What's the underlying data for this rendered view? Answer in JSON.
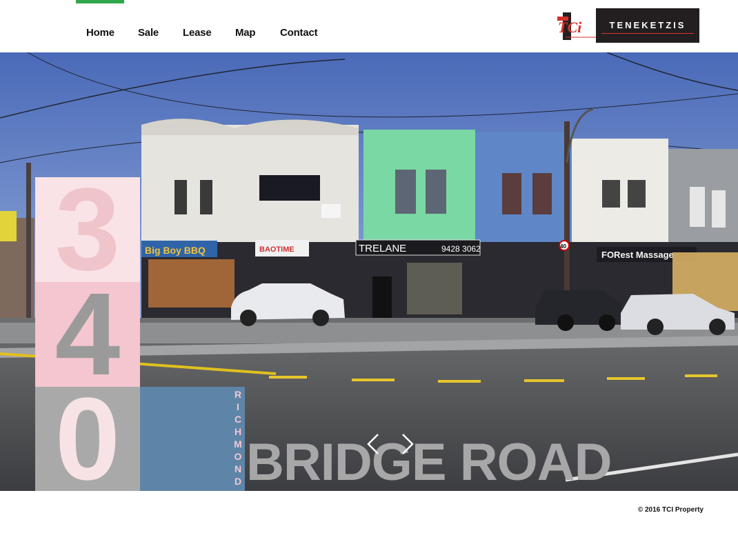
{
  "nav": {
    "items": [
      {
        "label": "Home",
        "active": true
      },
      {
        "label": "Sale",
        "active": false
      },
      {
        "label": "Lease",
        "active": false
      },
      {
        "label": "Map",
        "active": false
      },
      {
        "label": "Contact",
        "active": false
      }
    ]
  },
  "logo": {
    "mark": "TCi",
    "name": "TENEKETZIS"
  },
  "hero": {
    "street_number_digits": [
      "3",
      "4",
      "0"
    ],
    "suburb": "RICHMOND",
    "street_name": "BRIDGE ROAD",
    "signs": {
      "shop1": "Big Boy BBQ",
      "shop2": "BAOTIME",
      "shop3": "TRELANE",
      "shop3_phone": "9428 3062",
      "shop5": "FORest Massage",
      "speed": "40"
    }
  },
  "carousel": {
    "prev_icon": "chevron-left-icon",
    "next_icon": "chevron-right-icon"
  },
  "footer": {
    "copyright": "© 2016 TCI Property"
  },
  "colors": {
    "accent": "#2fa74a",
    "pink_light": "#f9e3e6",
    "pink": "#f4c6cf",
    "grey": "#a9a9a9",
    "blue": "#5e85a8",
    "logo_bg": "#231f20",
    "logo_red": "#d6302b"
  }
}
